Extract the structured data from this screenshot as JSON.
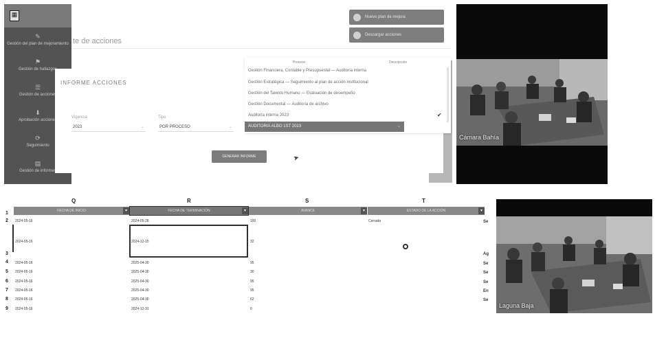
{
  "app": {
    "brand_text": "",
    "logo_text": "▦",
    "page_title": "te de acciones",
    "page_subtitle": "",
    "nav_items": [
      {
        "label": "Gestión del plan de mejoramiento",
        "icon": "✎"
      },
      {
        "label": "Gestión de hallazgos",
        "icon": "⚑"
      },
      {
        "label": "Gestión de acciones",
        "icon": "☰"
      },
      {
        "label": "Aprobación acciones",
        "icon": "⬇"
      },
      {
        "label": "Seguimiento",
        "icon": "⟳"
      },
      {
        "label": "Gestión de informes",
        "icon": "▤"
      }
    ],
    "pills": [
      {
        "label": "Nuevo plan de mejora"
      },
      {
        "label": "Descargar acciones"
      }
    ]
  },
  "modal": {
    "title": "INFORME ACCIONES",
    "fields": [
      {
        "label": "Vigencia",
        "value": "2023"
      },
      {
        "label": "Tipo",
        "value": "POR PROCESO"
      }
    ],
    "generate_button": "GENERAR INFORME"
  },
  "dropdown": {
    "col1_header": "Proceso",
    "col2_header": "Descripción",
    "items": [
      "Gestión Financiera, Contable y Presupuestal — Auditoría interna",
      "Gestión Estratégica — Seguimiento al plan de acción institucional",
      "Gestión del Talento Humano — Evaluación de desempeño",
      "Gestión Documental — Auditoría de archivo",
      "Auditoría interna 2023"
    ],
    "selected": "AUDITORIA ALBO 1ST 2023"
  },
  "videos": [
    {
      "name": "Cámara Bahía"
    },
    {
      "name": "Laguna Baja"
    }
  ],
  "sheet": {
    "columns": [
      {
        "letter": "Q",
        "header": "FECHA DE INICIO"
      },
      {
        "letter": "R",
        "header": "FECHA DE TERMINACIÓN"
      },
      {
        "letter": "S",
        "header": "AVANCE"
      },
      {
        "letter": "T",
        "header": "ESTADO DE LA ACCIÓN"
      }
    ],
    "row_numbers": [
      "1",
      "2",
      "3",
      "4",
      "5",
      "6",
      "7",
      "8",
      "9"
    ],
    "rows": [
      {
        "start": "2024-05-16",
        "end": "2024-05-28",
        "progress": "100",
        "status": "Cerrada",
        "right": "Se"
      },
      {
        "start": "2024-05-16",
        "end": "2024-12-15",
        "progress": "32",
        "status": "",
        "right": "Ag"
      },
      {
        "start": "2024-05-16",
        "end": "2025-04-30",
        "progress": "95",
        "status": "",
        "right": "Se"
      },
      {
        "start": "2024-05-16",
        "end": "2025-04-30",
        "progress": "30",
        "status": "",
        "right": "Se"
      },
      {
        "start": "2024-05-16",
        "end": "2025-04-30",
        "progress": "95",
        "status": "",
        "right": "Se"
      },
      {
        "start": "2024-05-16",
        "end": "2025-04-30",
        "progress": "95",
        "status": "",
        "right": "En"
      },
      {
        "start": "2024-05-16",
        "end": "2025-04-30",
        "progress": "62",
        "status": "",
        "right": "Se"
      },
      {
        "start": "2024-05-16",
        "end": "2024-12-31",
        "progress": "0",
        "status": "",
        "right": ""
      }
    ]
  }
}
